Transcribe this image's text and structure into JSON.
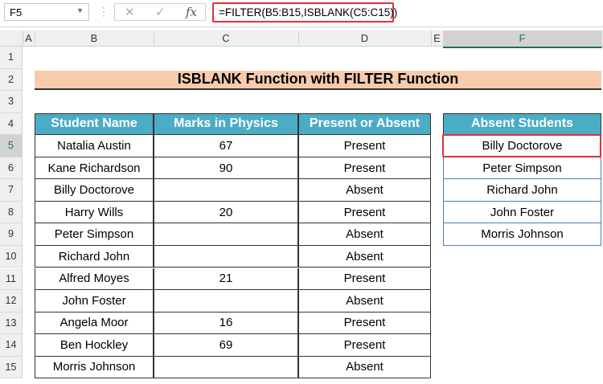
{
  "name_box": "F5",
  "formula": "=FILTER(B5:B15,ISBLANK(C5:C15))",
  "columns": [
    "A",
    "B",
    "C",
    "D",
    "E",
    "F"
  ],
  "rows": [
    "1",
    "2",
    "3",
    "4",
    "5",
    "6",
    "7",
    "8",
    "9",
    "10",
    "11",
    "12",
    "13",
    "14",
    "15"
  ],
  "title": "ISBLANK Function with FILTER Function",
  "headers": [
    "Student Name",
    "Marks in Physics",
    "Present or Absent"
  ],
  "students": [
    [
      "Natalia Austin",
      "67",
      "Present"
    ],
    [
      "Kane Richardson",
      "90",
      "Present"
    ],
    [
      "Billy Doctorove",
      "",
      "Absent"
    ],
    [
      "Harry Wills",
      "20",
      "Present"
    ],
    [
      "Peter Simpson",
      "",
      "Absent"
    ],
    [
      "Richard John",
      "",
      "Absent"
    ],
    [
      "Alfred Moyes",
      "21",
      "Present"
    ],
    [
      "John Foster",
      "",
      "Absent"
    ],
    [
      "Angela Moor",
      "16",
      "Present"
    ],
    [
      "Ben Hockley",
      "69",
      "Present"
    ],
    [
      "Morris Johnson",
      "",
      "Absent"
    ]
  ],
  "result_header": "Absent Students",
  "results": [
    "Billy Doctorove",
    "Peter Simpson",
    "Richard John",
    "John Foster",
    "Morris Johnson"
  ]
}
